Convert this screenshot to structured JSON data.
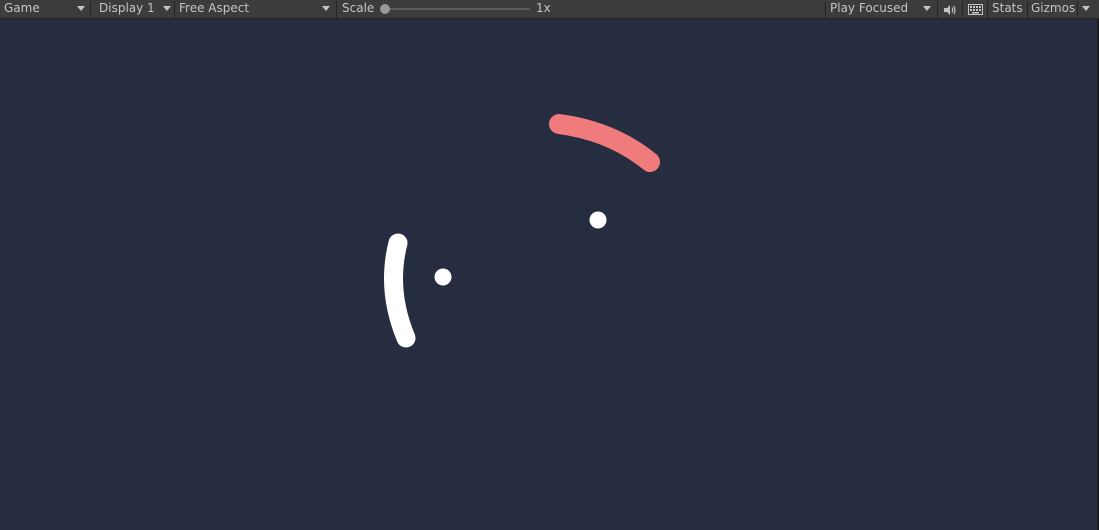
{
  "toolbar": {
    "view_mode": {
      "label": "Game",
      "icon": "chevron-down-icon"
    },
    "display": {
      "label": "Display 1",
      "icon": "chevron-down-icon"
    },
    "aspect": {
      "label": "Free Aspect",
      "icon": "chevron-down-icon"
    },
    "scale": {
      "label": "Scale",
      "value": 0,
      "value_label": "1x"
    },
    "play_mode": {
      "label": "Play Focused",
      "icon": "chevron-down-icon"
    },
    "audio_icon": "speaker-icon",
    "keyboard_icon": "keyboard-icon",
    "stats_label": "Stats",
    "gizmos": {
      "label": "Gizmos",
      "icon": "chevron-down-icon"
    }
  },
  "scene": {
    "background_color": "#272d40",
    "objects": [
      {
        "name": "red-arc",
        "color": "#f07b7d"
      },
      {
        "name": "white-dot-right",
        "color": "#ffffff"
      },
      {
        "name": "white-arc",
        "color": "#ffffff"
      },
      {
        "name": "white-dot-left",
        "color": "#ffffff"
      }
    ]
  }
}
